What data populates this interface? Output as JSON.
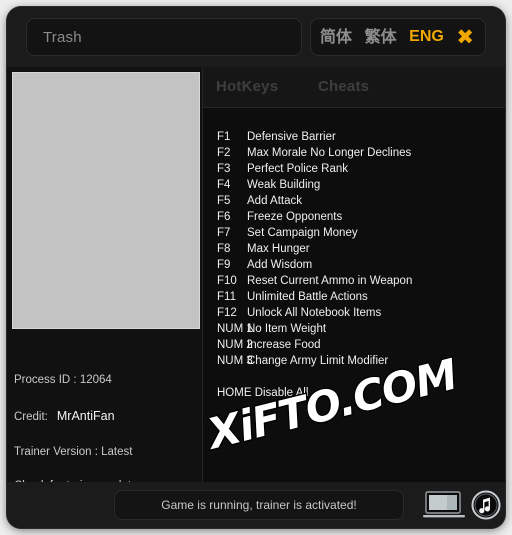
{
  "window": {
    "title_field_value": "Trash",
    "title_field_placeholder": "Trash"
  },
  "language_bar": {
    "simplified_label": "简体",
    "traditional_label": "繁体",
    "english_label": "ENG",
    "close_label": "✖",
    "active": "ENG",
    "active_color": "#f0a800"
  },
  "tabs": [
    {
      "id": "hotkeys",
      "label": "HotKeys"
    },
    {
      "id": "cheats",
      "label": "Cheats"
    }
  ],
  "cheats": [
    {
      "key": "F1",
      "label": "Defensive Barrier"
    },
    {
      "key": "F2",
      "label": "Max Morale No Longer Declines"
    },
    {
      "key": "F3",
      "label": "Perfect Police Rank"
    },
    {
      "key": "F4",
      "label": "Weak Building"
    },
    {
      "key": "F5",
      "label": "Add Attack"
    },
    {
      "key": "F6",
      "label": "Freeze Opponents"
    },
    {
      "key": "F7",
      "label": "Set Campaign Money"
    },
    {
      "key": "F8",
      "label": "Max Hunger"
    },
    {
      "key": "F9",
      "label": "Add Wisdom"
    },
    {
      "key": "F10",
      "label": "Reset Current Ammo in Weapon"
    },
    {
      "key": "F11",
      "label": "Unlimited Battle Actions"
    },
    {
      "key": "F12",
      "label": "Unlock All Notebook Items"
    },
    {
      "key": "NUM 1",
      "label": "No Item Weight"
    },
    {
      "key": "NUM 2",
      "label": "Increase Food"
    },
    {
      "key": "NUM 3",
      "label": "Change Army Limit Modifier"
    }
  ],
  "disable_all": "HOME Disable All",
  "info": {
    "process_id": "Process ID : 12064",
    "credit_label": "Credit:",
    "credit_value": "MrAntiFan",
    "trainer_version": "Trainer Version : Latest",
    "update_link": "Check for trainer update"
  },
  "status": {
    "message": "Game is running, trainer is activated!"
  },
  "icons": {
    "monitor": "monitor-icon",
    "music": "music-note-icon"
  },
  "watermark": "XiFTO.COM"
}
